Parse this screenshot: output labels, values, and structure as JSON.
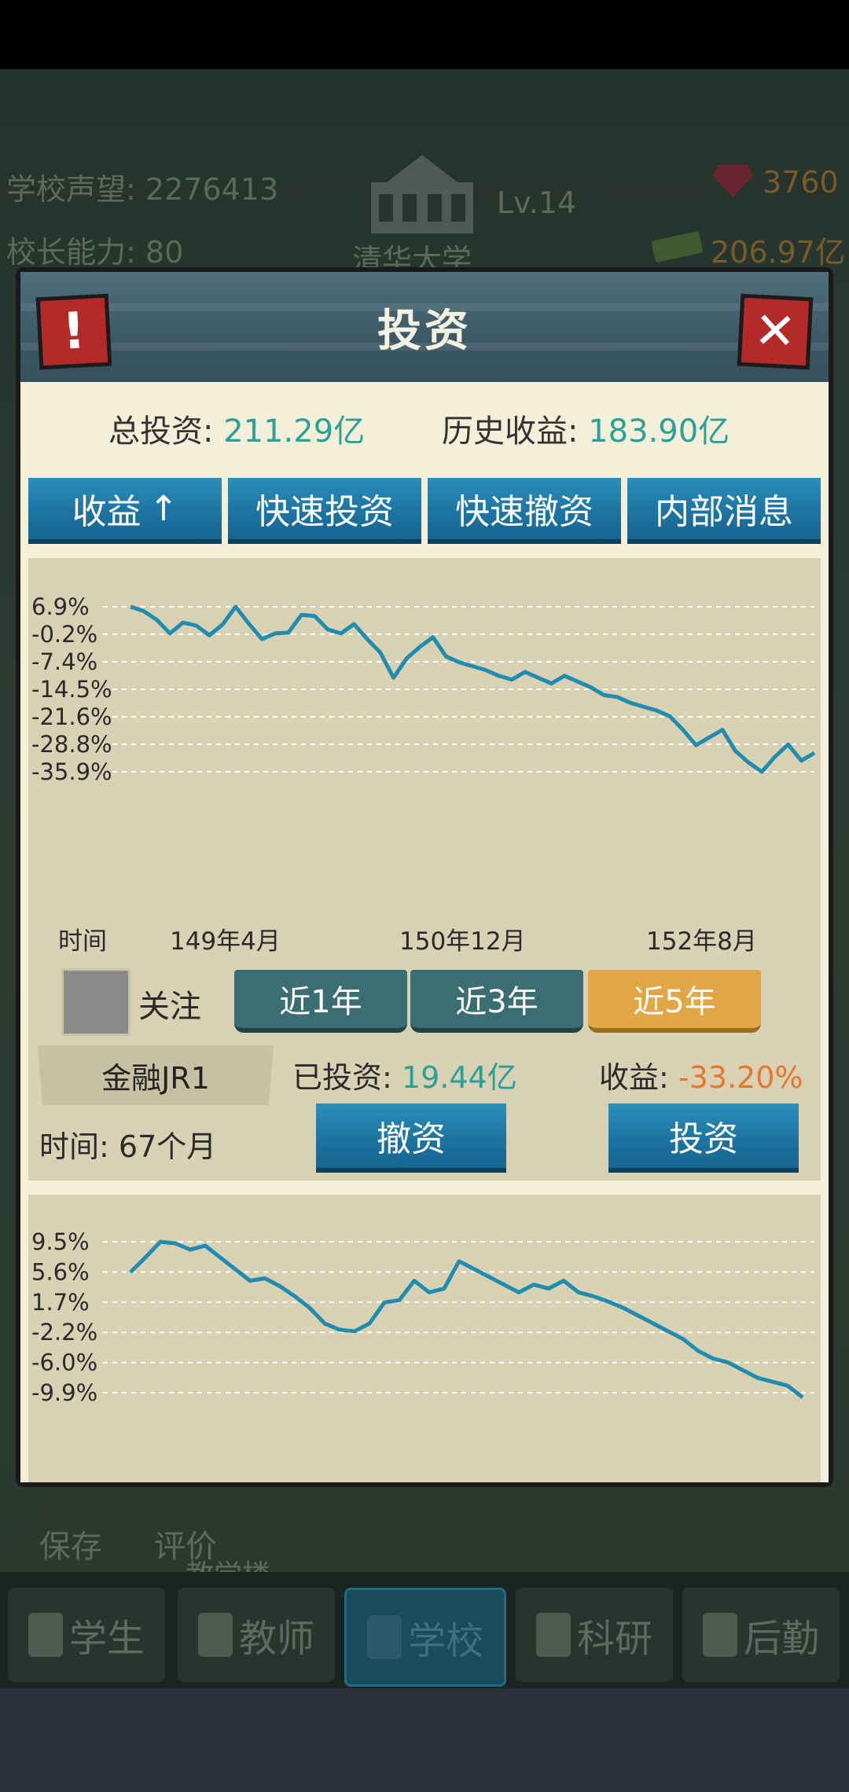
{
  "hud": {
    "reputation_label": "学校声望:",
    "reputation_value": "2276413",
    "ability_label": "校长能力:",
    "ability_value": "80",
    "level": "Lv.14",
    "school_name": "清华大学",
    "gems": "3760",
    "money": "206.97亿"
  },
  "background_buttons": {
    "save": "保存",
    "evaluate": "评价",
    "building": "教学楼"
  },
  "bottom_nav": [
    {
      "label": "学生",
      "icon": "student-icon"
    },
    {
      "label": "教师",
      "icon": "teacher-icon"
    },
    {
      "label": "学校",
      "icon": "school-icon",
      "active": true
    },
    {
      "label": "科研",
      "icon": "flask-icon"
    },
    {
      "label": "后勤",
      "icon": "clipboard-icon"
    }
  ],
  "dialog": {
    "title": "投资",
    "alert_glyph": "!",
    "close_glyph": "✕",
    "total_invest_label": "总投资:",
    "total_invest_value": "211.29亿",
    "history_profit_label": "历史收益:",
    "history_profit_value": "183.90亿",
    "tabs": [
      {
        "label": "收益",
        "arrow": "↑"
      },
      {
        "label": "快速投资"
      },
      {
        "label": "快速撤资"
      },
      {
        "label": "内部消息"
      }
    ]
  },
  "fund1": {
    "name": "金融JR1",
    "follow_label": "关注",
    "time_axis_label": "时间",
    "x_ticks": [
      "149年4月",
      "150年12月",
      "152年8月"
    ],
    "ranges": [
      {
        "label": "近1年",
        "active": false
      },
      {
        "label": "近3年",
        "active": false
      },
      {
        "label": "近5年",
        "active": true
      }
    ],
    "invested_label": "已投资:",
    "invested_value": "19.44亿",
    "return_label": "收益:",
    "return_value": "-33.20%",
    "time_label": "时间:",
    "time_value": "67个月",
    "withdraw_button": "撤资",
    "invest_button": "投资"
  },
  "colors": {
    "accent_teal": "#2aa198",
    "negative_orange": "#e8772e",
    "line_blue": "#1f8cb0",
    "button_blue": "#1d74a2",
    "active_range": "#e2a646"
  },
  "chart_data": [
    {
      "type": "line",
      "y_ticks": [
        "6.9%",
        "-0.2%",
        "-7.4%",
        "-14.5%",
        "-21.6%",
        "-28.8%",
        "-35.9%"
      ],
      "ylim": [
        -35.9,
        6.9
      ],
      "x_ticks": [
        "149年4月",
        "150年12月",
        "152年8月"
      ],
      "grid": true,
      "values": [
        6.9,
        5.8,
        3.5,
        0.0,
        2.8,
        2.0,
        -0.5,
        2.3,
        6.9,
        2.5,
        -1.5,
        0.0,
        0.2,
        4.8,
        4.5,
        1.0,
        0.0,
        2.4,
        -1.5,
        -5.0,
        -11.5,
        -6.5,
        -3.5,
        -1.0,
        -6.0,
        -7.5,
        -8.5,
        -9.5,
        -11.0,
        -12.0,
        -10.0,
        -11.5,
        -13.0,
        -11.0,
        -12.5,
        -14.0,
        -16.0,
        -16.5,
        -18.0,
        -19.0,
        -20.0,
        -21.5,
        -25.0,
        -29.0,
        -27.0,
        -25.0,
        -30.5,
        -33.5,
        -35.9,
        -32.0,
        -28.8,
        -33.0,
        -31.0
      ]
    },
    {
      "type": "line",
      "y_ticks": [
        "9.5%",
        "5.6%",
        "1.7%",
        "-2.2%",
        "-6.0%",
        "-9.9%"
      ],
      "ylim": [
        -9.9,
        9.5
      ],
      "grid": true,
      "values": [
        5.6,
        7.5,
        9.5,
        9.3,
        8.5,
        9.0,
        7.5,
        6.0,
        4.5,
        4.8,
        3.8,
        2.5,
        1.0,
        -1.0,
        -1.8,
        -2.0,
        -1.0,
        1.7,
        2.0,
        4.5,
        3.0,
        3.5,
        7.0,
        6.0,
        5.0,
        4.0,
        3.0,
        4.0,
        3.5,
        4.5,
        3.0,
        2.5,
        1.8,
        1.0,
        0.0,
        -1.0,
        -2.0,
        -3.0,
        -4.5,
        -5.5,
        -6.0,
        -7.0,
        -8.0,
        -8.5,
        -9.0,
        -10.5
      ]
    }
  ]
}
